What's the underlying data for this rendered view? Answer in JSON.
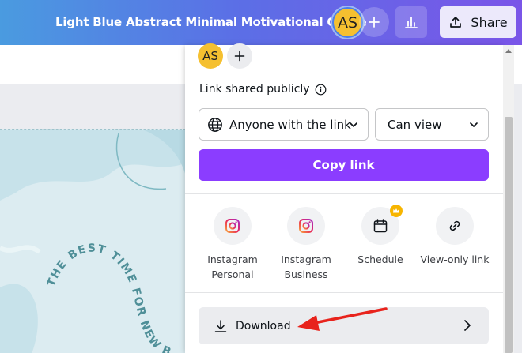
{
  "header": {
    "doc_title": "Light Blue Abstract Minimal Motivational Quote",
    "avatar_initials": "AS",
    "share_label": "Share"
  },
  "share_panel": {
    "avatar_initials": "AS",
    "link_label": "Link shared publicly",
    "access_select": "Anyone with the link",
    "permission_select": "Can view",
    "copy_link_label": "Copy link",
    "options": [
      {
        "label_line1": "Instagram",
        "label_line2": "Personal",
        "icon": "instagram-icon"
      },
      {
        "label_line1": "Instagram",
        "label_line2": "Business",
        "icon": "instagram-icon"
      },
      {
        "label_line1": "Schedule",
        "label_line2": "",
        "icon": "calendar-icon"
      },
      {
        "label_line1": "View-only link",
        "label_line2": "",
        "icon": "link-icon"
      }
    ],
    "download_label": "Download"
  },
  "design": {
    "quote_text": "THE BEST TIME FOR NEW BEGINNINGS"
  },
  "colors": {
    "accent": "#8b3dff",
    "avatar": "#f5c030",
    "annotation_arrow": "#e8231c",
    "design_text": "#4f8f98"
  }
}
